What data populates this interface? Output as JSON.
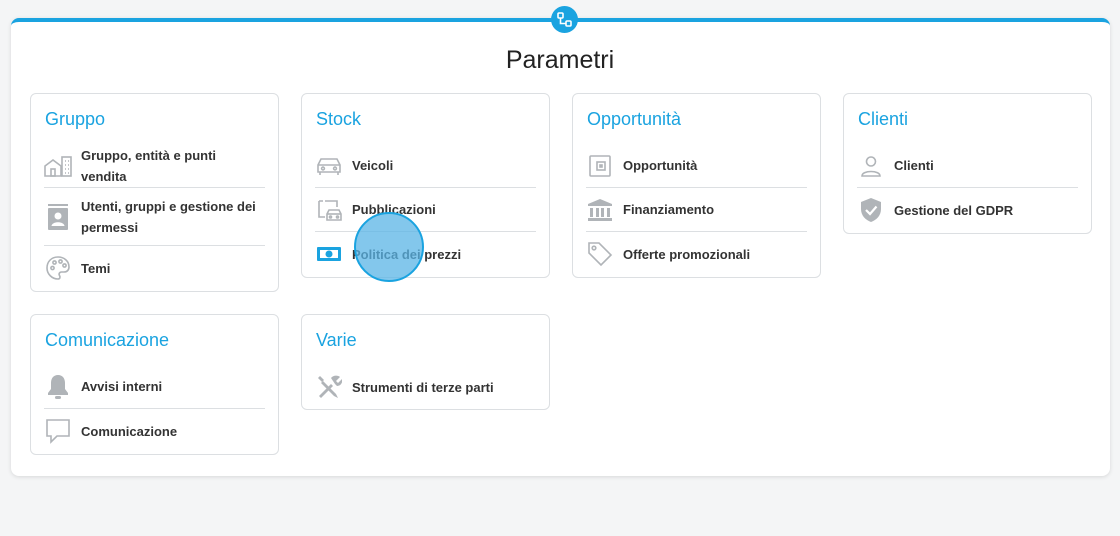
{
  "page": {
    "title": "Parametri"
  },
  "cards": {
    "gruppo": {
      "title": "Gruppo",
      "items": [
        {
          "label": "Gruppo, entità e punti vendita",
          "icon": "building-icon"
        },
        {
          "label": "Utenti, gruppi e gestione dei permessi",
          "icon": "user-badge-icon"
        },
        {
          "label": "Temi",
          "icon": "palette-icon"
        }
      ]
    },
    "stock": {
      "title": "Stock",
      "items": [
        {
          "label": "Veicoli",
          "icon": "car-icon"
        },
        {
          "label": "Pubblicazioni",
          "icon": "car-screen-icon"
        },
        {
          "label": "Politica dei prezzi",
          "icon": "banknote-icon"
        }
      ]
    },
    "opportunita": {
      "title": "Opportunità",
      "items": [
        {
          "label": "Opportunità",
          "icon": "opportunity-icon"
        },
        {
          "label": "Finanziamento",
          "icon": "bank-icon"
        },
        {
          "label": "Offerte promozionali",
          "icon": "tag-icon"
        }
      ]
    },
    "clienti": {
      "title": "Clienti",
      "items": [
        {
          "label": "Clienti",
          "icon": "person-icon"
        },
        {
          "label": "Gestione del GDPR",
          "icon": "shield-check-icon"
        }
      ]
    },
    "comunicazione": {
      "title": "Comunicazione",
      "items": [
        {
          "label": "Avvisi interni",
          "icon": "bell-icon"
        },
        {
          "label": "Comunicazione",
          "icon": "speech-bubble-icon"
        }
      ]
    },
    "varie": {
      "title": "Varie",
      "items": [
        {
          "label": "Strumenti di terze parti",
          "icon": "tools-icon"
        }
      ]
    }
  },
  "colors": {
    "accent": "#1aa3e0",
    "icon_gray": "#b0b4b8",
    "highlight_icon": "#1aa3e0"
  }
}
